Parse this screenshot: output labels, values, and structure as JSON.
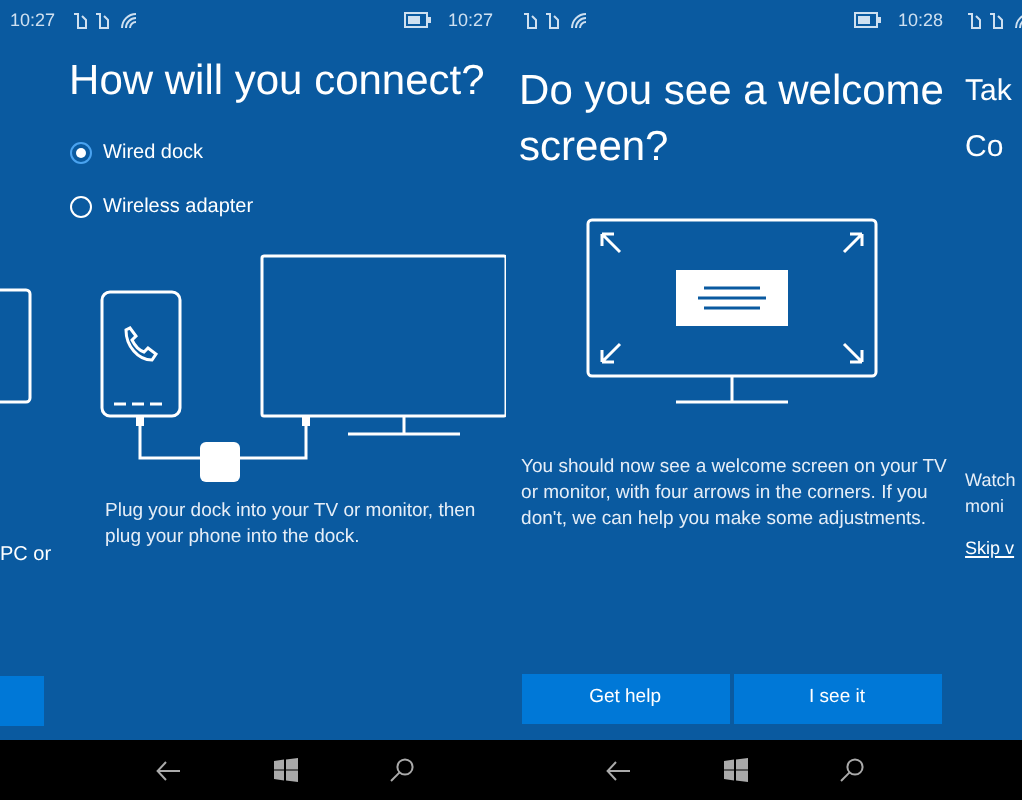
{
  "screens": [
    {
      "kind": "partial_left",
      "time": "10:27",
      "caption": "PC or"
    },
    {
      "kind": "connect",
      "time": "10:27",
      "title": "How will you connect?",
      "options": [
        {
          "label": "Wired dock",
          "selected": true
        },
        {
          "label": "Wireless adapter",
          "selected": false
        }
      ],
      "caption": "Plug your dock into your TV or monitor, then plug your phone into the dock."
    },
    {
      "kind": "welcome",
      "time": "10:28",
      "title": "Do you see a welcome screen?",
      "body": "You should now see a welcome screen on your TV or monitor, with four arrows in the corners. If you don't, we can help you make some adjustments.",
      "buttons": [
        "Get help",
        "I see it"
      ]
    },
    {
      "kind": "partial_right",
      "title_lines": [
        "Tak",
        "Co"
      ],
      "body_lines": [
        "Watch",
        "moni"
      ],
      "link": "Skip v"
    }
  ]
}
